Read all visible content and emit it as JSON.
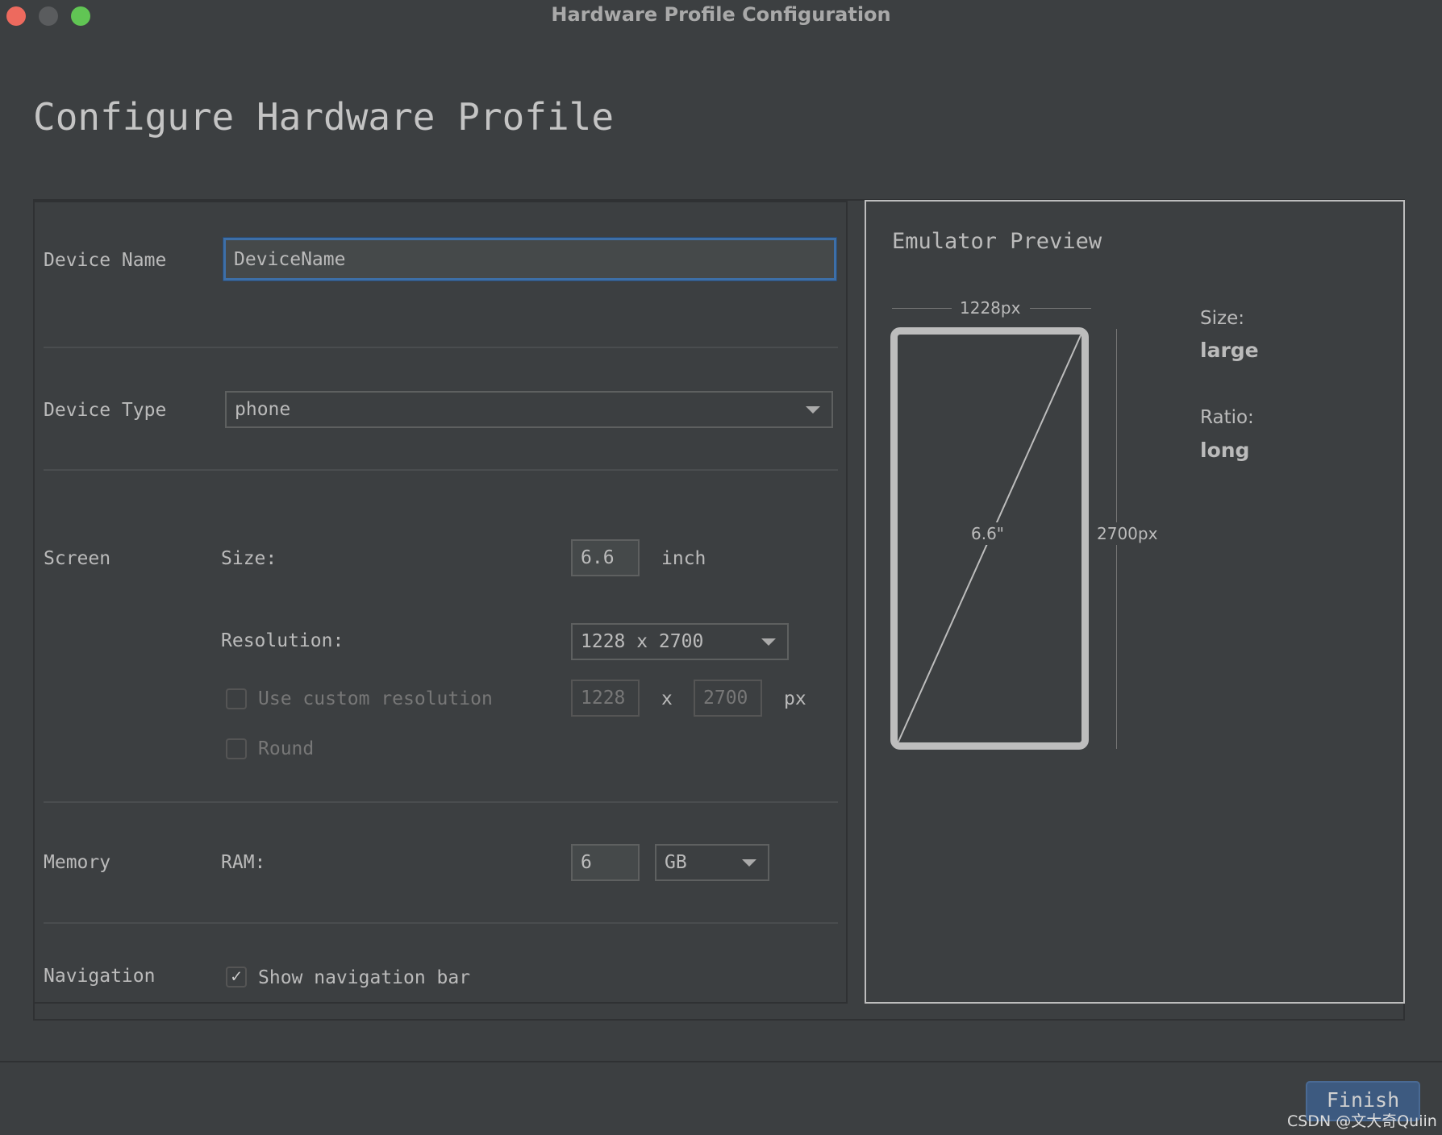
{
  "window": {
    "title": "Hardware Profile Configuration"
  },
  "heading": "Configure Hardware Profile",
  "form": {
    "device_name": {
      "label": "Device Name",
      "value": "DeviceName"
    },
    "device_type": {
      "label": "Device Type",
      "value": "phone"
    },
    "screen": {
      "label": "Screen",
      "size_label": "Size:",
      "size_value": "6.6",
      "size_unit": "inch",
      "resolution_label": "Resolution:",
      "resolution_value": "1228 x 2700",
      "custom_resolution_label": "Use custom resolution",
      "custom_resolution_checked": false,
      "custom_width": "1228",
      "custom_x": "x",
      "custom_height": "2700",
      "custom_unit": "px",
      "round_label": "Round",
      "round_checked": false
    },
    "memory": {
      "label": "Memory",
      "ram_label": "RAM:",
      "ram_value": "6",
      "ram_unit": "GB"
    },
    "navigation": {
      "label": "Navigation",
      "show_nav_label": "Show navigation bar",
      "show_nav_checked": true,
      "check_glyph": "✓"
    }
  },
  "preview": {
    "title": "Emulator Preview",
    "width_label": "1228px",
    "height_label": "2700px",
    "diagonal_label": "6.6\"",
    "size_label": "Size:",
    "size_value": "large",
    "ratio_label": "Ratio:",
    "ratio_value": "long"
  },
  "buttons": {
    "finish": "Finish"
  },
  "watermark": "CSDN @文大奇Quiin",
  "colors": {
    "accent": "#3d5a80",
    "close": "#ed6a5e",
    "zoom": "#61c554"
  }
}
